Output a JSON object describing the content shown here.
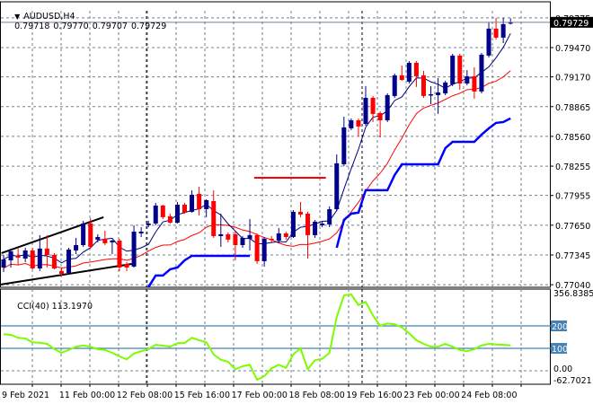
{
  "header": {
    "symbol": "AUDUSD,H4",
    "open": "0.79718",
    "high": "0.79770",
    "low": "0.79707",
    "close": "0.79729",
    "menu_icon": "triangle-down-icon"
  },
  "current_price_label": "0.79729",
  "price_axis": {
    "labels": [
      "0.79775",
      "0.79470",
      "0.79170",
      "0.78865",
      "0.78560",
      "0.78255",
      "0.77955",
      "0.77650",
      "0.77345",
      "0.77040"
    ]
  },
  "cci": {
    "title": "CCI(40)",
    "value": "113.1970",
    "axis_labels": [
      "356.8385",
      "0.00",
      "-62.7021"
    ],
    "levels": [
      "200",
      "100"
    ],
    "values": [
      163,
      160,
      147,
      144,
      127,
      125,
      120,
      97,
      80,
      93,
      107,
      113,
      107,
      96,
      93,
      80,
      64,
      51,
      77,
      87,
      96,
      116,
      112,
      107,
      123,
      124,
      147,
      136,
      127,
      73,
      49,
      40,
      7,
      20,
      27,
      -40,
      -24,
      11,
      27,
      13,
      73,
      100,
      7,
      47,
      53,
      80,
      240,
      336,
      340,
      293,
      307,
      247,
      200,
      211,
      207,
      193,
      167,
      136,
      120,
      107,
      107,
      120,
      107,
      93,
      87,
      96,
      113,
      120,
      117,
      116,
      113.197
    ]
  },
  "time_axis": {
    "labels": [
      "9 Feb 2021",
      "11 Feb 00:00",
      "12 Feb 08:00",
      "15 Feb 16:00",
      "17 Feb 00:00",
      "18 Feb 08:00",
      "19 Feb 16:00",
      "23 Feb 00:00",
      "24 Feb 08:00"
    ]
  },
  "colors": {
    "bull": "#00008b",
    "bear": "#ff0000",
    "fast_ma": "#000080",
    "slow_ma": "#ff0000",
    "stop_line": "#0000ff",
    "cci_line": "#7cfc00",
    "level_line": "#4682b4",
    "grid": "#708090"
  },
  "chart_data": {
    "type": "candlestick",
    "candles": [
      [
        0.77216,
        0.77345,
        0.7717,
        0.77299
      ],
      [
        0.7729,
        0.7741,
        0.77216,
        0.77382
      ],
      [
        0.77336,
        0.7741,
        0.77244,
        0.77318
      ],
      [
        0.77308,
        0.77419,
        0.77272,
        0.77391
      ],
      [
        0.77391,
        0.77419,
        0.77198,
        0.77207
      ],
      [
        0.77207,
        0.77548,
        0.7718,
        0.7741
      ],
      [
        0.7741,
        0.77548,
        0.77216,
        0.77345
      ],
      [
        0.77345,
        0.77364,
        0.77198,
        0.77207
      ],
      [
        0.7718,
        0.77216,
        0.77124,
        0.77152
      ],
      [
        0.77161,
        0.77419,
        0.77152,
        0.774
      ],
      [
        0.77391,
        0.7752,
        0.77354,
        0.77446
      ],
      [
        0.77446,
        0.77695,
        0.77428,
        0.77667
      ],
      [
        0.77667,
        0.77722,
        0.7741,
        0.77428
      ],
      [
        0.77502,
        0.77557,
        0.77474,
        0.77529
      ],
      [
        0.77511,
        0.77594,
        0.77446,
        0.77465
      ],
      [
        0.77474,
        0.77502,
        0.77354,
        0.77492
      ],
      [
        0.77492,
        0.77511,
        0.7718,
        0.77216
      ],
      [
        0.77253,
        0.77272,
        0.7718,
        0.77216
      ],
      [
        0.77226,
        0.77649,
        0.77216,
        0.77584
      ],
      [
        0.77566,
        0.7763,
        0.77529,
        0.77584
      ],
      [
        0.77649,
        0.77695,
        0.7763,
        0.77667
      ],
      [
        0.77667,
        0.77879,
        0.77649,
        0.77851
      ],
      [
        0.77851,
        0.7786,
        0.77713,
        0.77732
      ],
      [
        0.77741,
        0.77768,
        0.77667,
        0.77676
      ],
      [
        0.77676,
        0.77888,
        0.77667,
        0.7786
      ],
      [
        0.7786,
        0.77879,
        0.77768,
        0.77778
      ],
      [
        0.77787,
        0.78008,
        0.77778,
        0.77962
      ],
      [
        0.77971,
        0.78044,
        0.7775,
        0.77814
      ],
      [
        0.77814,
        0.77916,
        0.77732,
        0.77906
      ],
      [
        0.77897,
        0.78008,
        0.7752,
        0.77538
      ],
      [
        0.77538,
        0.77768,
        0.77428,
        0.77557
      ],
      [
        0.77557,
        0.77575,
        0.77474,
        0.77502
      ],
      [
        0.77557,
        0.77584,
        0.7729,
        0.77446
      ],
      [
        0.77446,
        0.77538,
        0.77419,
        0.7752
      ],
      [
        0.77511,
        0.77713,
        0.77391,
        0.77548
      ],
      [
        0.77548,
        0.77566,
        0.77253,
        0.77281
      ],
      [
        0.77281,
        0.77529,
        0.77226,
        0.77511
      ],
      [
        0.77511,
        0.77538,
        0.77474,
        0.77502
      ],
      [
        0.77492,
        0.77621,
        0.77465,
        0.77566
      ],
      [
        0.77566,
        0.77584,
        0.77502,
        0.77529
      ],
      [
        0.77529,
        0.77805,
        0.7752,
        0.77787
      ],
      [
        0.77787,
        0.77888,
        0.77732,
        0.77759
      ],
      [
        0.77768,
        0.77787,
        0.77308,
        0.77548
      ],
      [
        0.77548,
        0.77704,
        0.7752,
        0.77686
      ],
      [
        0.77649,
        0.77686,
        0.7763,
        0.77667
      ],
      [
        0.77658,
        0.77842,
        0.7763,
        0.77814
      ],
      [
        0.77814,
        0.78376,
        0.77796,
        0.78284
      ],
      [
        0.78274,
        0.78762,
        0.78255,
        0.78652
      ],
      [
        0.78642,
        0.78744,
        0.78624,
        0.78725
      ],
      [
        0.78725,
        0.78744,
        0.7856,
        0.78661
      ],
      [
        0.78688,
        0.79075,
        0.7867,
        0.78955
      ],
      [
        0.78955,
        0.78974,
        0.78707,
        0.7879
      ],
      [
        0.78799,
        0.78817,
        0.7855,
        0.78725
      ],
      [
        0.78725,
        0.79001,
        0.78707,
        0.78983
      ],
      [
        0.78974,
        0.79204,
        0.78955,
        0.79185
      ],
      [
        0.79185,
        0.79286,
        0.7913,
        0.79139
      ],
      [
        0.79121,
        0.79332,
        0.79102,
        0.79314
      ],
      [
        0.79314,
        0.79332,
        0.79066,
        0.79176
      ],
      [
        0.79185,
        0.79231,
        0.78955,
        0.78974
      ],
      [
        0.78983,
        0.79075,
        0.78891,
        0.78992
      ],
      [
        0.78983,
        0.79158,
        0.7879,
        0.7901
      ],
      [
        0.79001,
        0.7913,
        0.78983,
        0.79112
      ],
      [
        0.79093,
        0.79406,
        0.79075,
        0.79388
      ],
      [
        0.79388,
        0.79406,
        0.79038,
        0.79102
      ],
      [
        0.79102,
        0.7924,
        0.79084,
        0.79176
      ],
      [
        0.79176,
        0.79268,
        0.78946,
        0.7902
      ],
      [
        0.7902,
        0.79415,
        0.79001,
        0.79397
      ],
      [
        0.79388,
        0.79728,
        0.79369,
        0.79664
      ],
      [
        0.79664,
        0.79774,
        0.79553,
        0.79572
      ],
      [
        0.79572,
        0.79774,
        0.79516,
        0.7971
      ],
      [
        0.79718,
        0.7977,
        0.79707,
        0.79729
      ]
    ],
    "stop_line_segments": [
      {
        "start": 20,
        "values": [
          0.77014,
          0.77134,
          0.77134,
          0.77198,
          0.77216,
          0.7729,
          0.77336,
          0.77336,
          0.77336,
          0.77336,
          0.77336,
          0.77336,
          0.77336,
          0.77336,
          0.77336
        ]
      },
      {
        "start": 46,
        "values": [
          0.77419,
          0.77704,
          0.77768,
          0.77778,
          0.78008,
          0.78008,
          0.78008,
          0.78008,
          0.78164,
          0.78274,
          0.78274,
          0.78274,
          0.78274,
          0.78274,
          0.78274,
          0.7844,
          0.78504,
          0.78504,
          0.78504,
          0.78504,
          0.78578,
          0.78642,
          0.78698,
          0.78707,
          0.78744
        ]
      }
    ],
    "horizontal_level": {
      "price": 0.78136,
      "from": 34.6,
      "to": 44.5
    },
    "trendlines": [
      {
        "from": [
          -0.3,
          0.77364
        ],
        "to": [
          13.8,
          0.77732
        ]
      },
      {
        "from": [
          -0.5,
          0.77042
        ],
        "to": [
          17.7,
          0.77253
        ]
      }
    ],
    "ylim": [
      0.7704,
      0.79775
    ]
  }
}
